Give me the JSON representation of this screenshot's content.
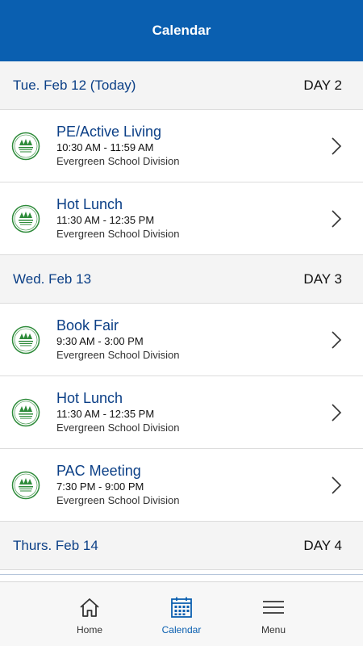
{
  "header": {
    "title": "Calendar"
  },
  "days": [
    {
      "date": "Tue. Feb 12 (Today)",
      "day": "DAY 2",
      "events": [
        {
          "title": "PE/Active Living",
          "time": "10:30 AM - 11:59 AM",
          "org": "Evergreen School Division"
        },
        {
          "title": "Hot Lunch",
          "time": "11:30 AM - 12:35 PM",
          "org": "Evergreen School Division"
        }
      ]
    },
    {
      "date": "Wed. Feb 13",
      "day": "DAY 3",
      "events": [
        {
          "title": "Book Fair",
          "time": "9:30 AM - 3:00 PM",
          "org": "Evergreen School Division"
        },
        {
          "title": "Hot Lunch",
          "time": "11:30 AM - 12:35 PM",
          "org": "Evergreen School Division"
        },
        {
          "title": "PAC Meeting",
          "time": "7:30 PM - 9:00 PM",
          "org": "Evergreen School Division"
        }
      ]
    },
    {
      "date": "Thurs. Feb 14",
      "day": "DAY 4",
      "events": []
    }
  ],
  "tabbar": {
    "home": "Home",
    "calendar": "Calendar",
    "menu": "Menu",
    "active": "calendar"
  },
  "colors": {
    "header_bg": "#0a5fb0",
    "accent": "#0b3f86",
    "logo_green": "#2e8b3a"
  }
}
